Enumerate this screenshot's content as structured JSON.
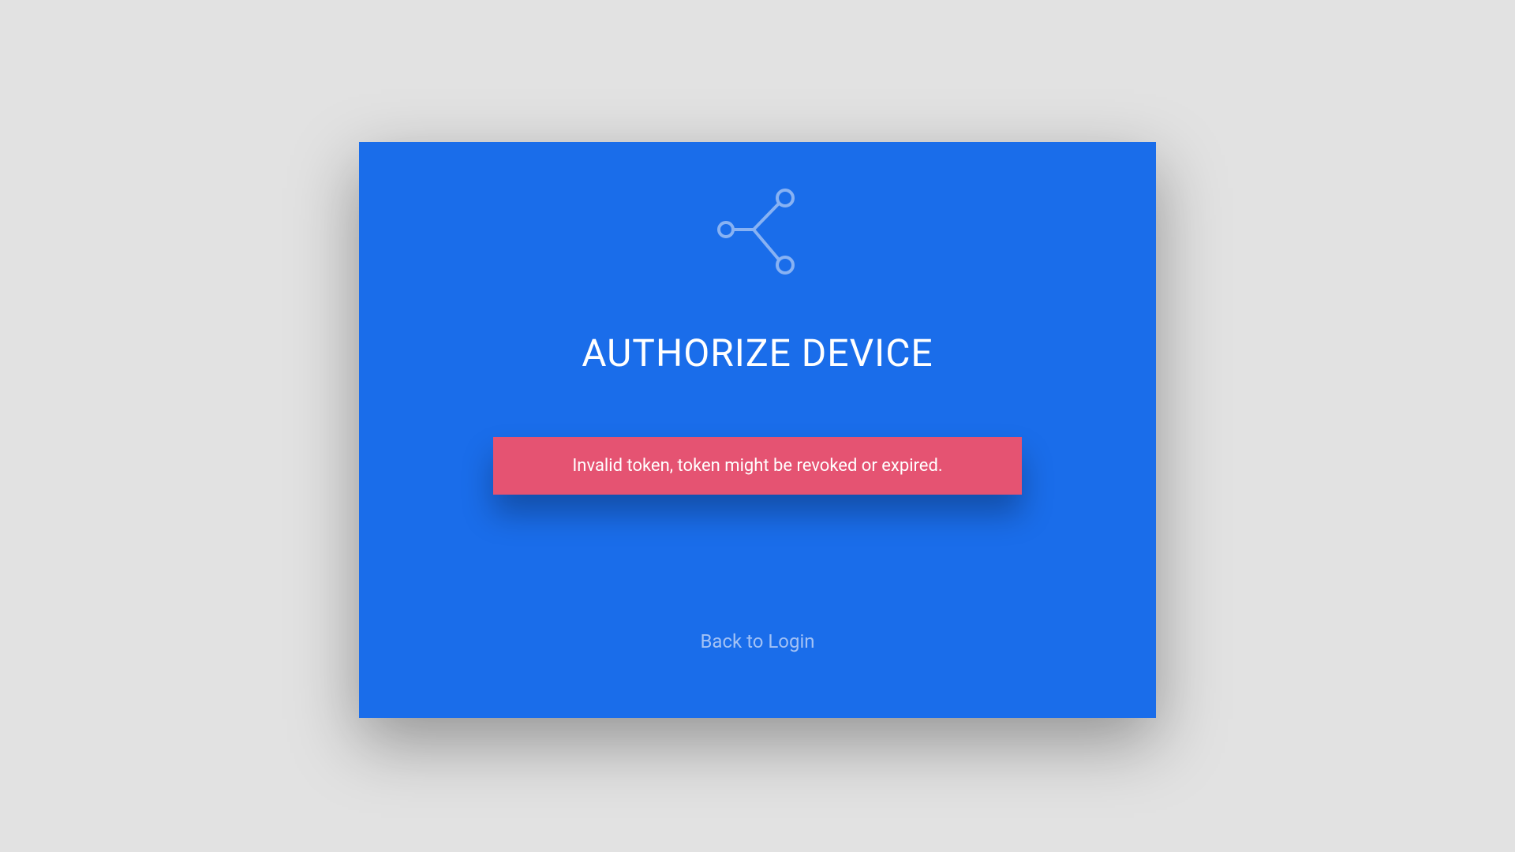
{
  "card": {
    "title": "AUTHORIZE DEVICE",
    "error_message": "Invalid token, token might be revoked or expired.",
    "back_link_label": "Back to Login"
  },
  "colors": {
    "card_bg": "#1a6dea",
    "error_bg": "#e55372",
    "page_bg": "#e2e2e2"
  }
}
